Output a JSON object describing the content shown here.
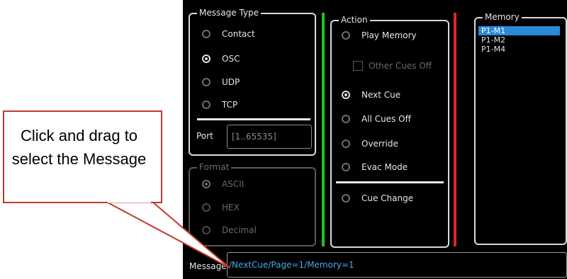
{
  "message_type": {
    "legend": "Message Type",
    "options": [
      {
        "label": "Contact",
        "checked": false
      },
      {
        "label": "OSC",
        "checked": true
      },
      {
        "label": "UDP",
        "checked": false
      },
      {
        "label": "TCP",
        "checked": false
      }
    ],
    "port_label": "Port",
    "port_placeholder": "[1..65535]"
  },
  "format": {
    "legend": "Format",
    "options": [
      {
        "label": "ASCII",
        "checked": true
      },
      {
        "label": "HEX",
        "checked": false
      },
      {
        "label": "Decimal",
        "checked": false
      }
    ]
  },
  "action": {
    "legend": "Action",
    "play_memory": "Play Memory",
    "other_cues_off": "Other Cues Off",
    "options": [
      {
        "label": "Next Cue",
        "checked": true
      },
      {
        "label": "All Cues Off",
        "checked": false
      },
      {
        "label": "Override",
        "checked": false
      },
      {
        "label": "Evac Mode",
        "checked": false
      }
    ],
    "cue_change": "Cue Change"
  },
  "memory": {
    "legend": "Memory",
    "items": [
      "P1-M1",
      "P1-M2",
      "P1-M4"
    ],
    "selected_index": 0
  },
  "message": {
    "label": "Message",
    "value": "/NextCue/Page=1/Memory=1"
  },
  "callout": {
    "text": "Click and drag to select the Message"
  },
  "colors": {
    "green_divider": "#22c025",
    "red_divider": "#e0262a",
    "selection": "#2a8ad8",
    "message_text": "#4aa8e8",
    "callout_border": "#c0392b"
  }
}
